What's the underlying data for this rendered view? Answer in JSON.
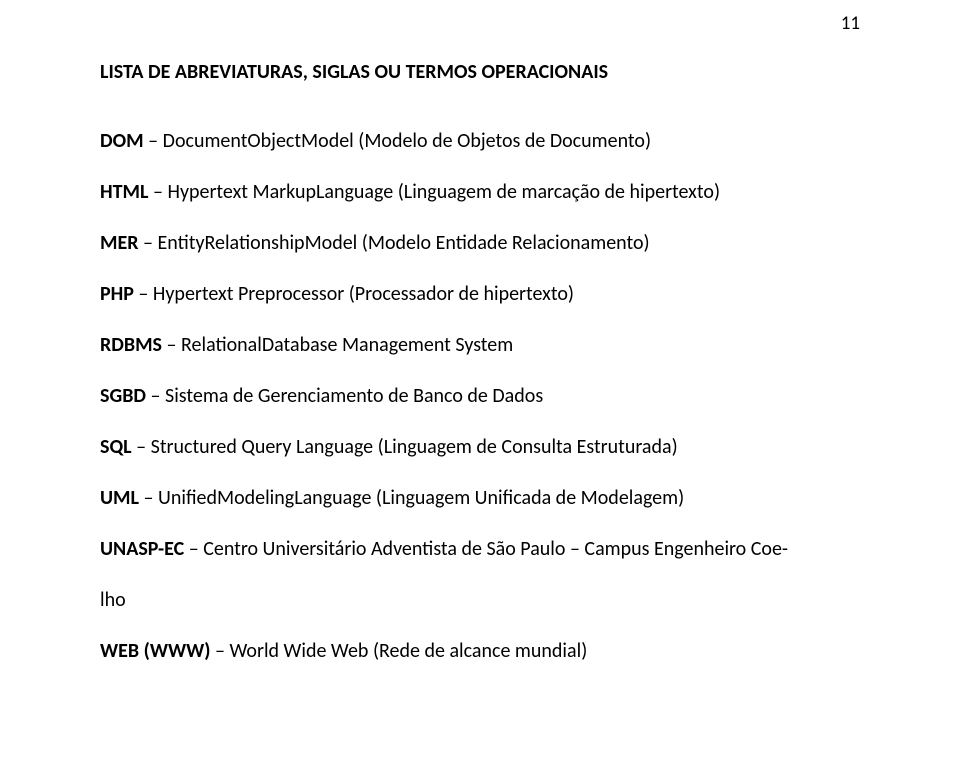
{
  "page_number": "11",
  "title": "LISTA DE ABREVIATURAS, SIGLAS OU TERMOS OPERACIONAIS",
  "entries": [
    {
      "abbr": "DOM",
      "sep": " – ",
      "desc": "DocumentObjectModel (Modelo de Objetos de Documento)"
    },
    {
      "abbr": "HTML",
      "sep": " – ",
      "desc": "Hypertext MarkupLanguage (Linguagem de marcação de hipertexto)"
    },
    {
      "abbr": "MER",
      "sep": " – ",
      "desc": "EntityRelationshipModel (Modelo Entidade Relacionamento)"
    },
    {
      "abbr": "PHP",
      "sep": " – ",
      "desc": "Hypertext Preprocessor (Processador de hipertexto)"
    },
    {
      "abbr": "RDBMS",
      "sep": " – ",
      "desc": "RelationalDatabase Management System"
    },
    {
      "abbr": "SGBD",
      "sep": " – ",
      "desc": "Sistema de Gerenciamento de Banco de Dados"
    },
    {
      "abbr": "SQL",
      "sep": " – ",
      "desc": "Structured Query Language (Linguagem de Consulta Estruturada)"
    },
    {
      "abbr": "UML",
      "sep": " – ",
      "desc": "UnifiedModelingLanguage (Linguagem Unificada de Modelagem)"
    }
  ],
  "unasp": {
    "abbr": "UNASP-EC",
    "sep": " – ",
    "line1": "Centro Universitário Adventista de São Paulo – Campus Engenheiro Coe-",
    "line2": "lho"
  },
  "web": {
    "abbr": "WEB (WWW)",
    "sep": " – ",
    "desc": "World Wide Web (Rede de alcance mundial)"
  }
}
